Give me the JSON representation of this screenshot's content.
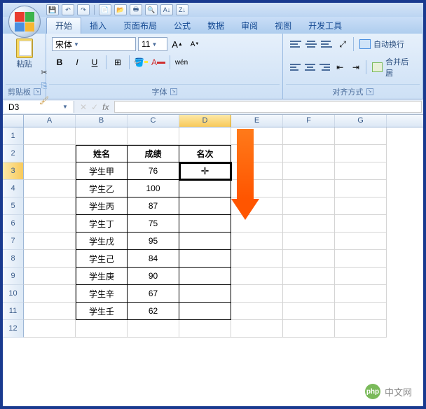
{
  "qat": {
    "save": "💾",
    "undo": "↶",
    "redo": "↷"
  },
  "tabs": [
    "开始",
    "插入",
    "页面布局",
    "公式",
    "数据",
    "审阅",
    "视图",
    "开发工具"
  ],
  "activeTab": 0,
  "ribbon": {
    "clipboard": {
      "paste": "粘贴",
      "label": "剪贴板"
    },
    "font": {
      "name": "宋体",
      "size": "11",
      "label": "字体"
    },
    "alignment": {
      "wrap": "自动换行",
      "merge": "合并后居",
      "label": "对齐方式"
    }
  },
  "namebox": "D3",
  "formula": "",
  "columns": [
    "A",
    "B",
    "C",
    "D",
    "E",
    "F",
    "G"
  ],
  "activeCol": "D",
  "activeRow": 3,
  "activeCell": "D3",
  "table": {
    "headers": [
      "姓名",
      "成绩",
      "名次"
    ],
    "rows": [
      {
        "name": "学生甲",
        "score": "76",
        "rank": ""
      },
      {
        "name": "学生乙",
        "score": "100",
        "rank": ""
      },
      {
        "name": "学生丙",
        "score": "87",
        "rank": ""
      },
      {
        "name": "学生丁",
        "score": "75",
        "rank": ""
      },
      {
        "name": "学生戊",
        "score": "95",
        "rank": ""
      },
      {
        "name": "学生己",
        "score": "84",
        "rank": ""
      },
      {
        "name": "学生庚",
        "score": "90",
        "rank": ""
      },
      {
        "name": "学生辛",
        "score": "67",
        "rank": ""
      },
      {
        "name": "学生壬",
        "score": "62",
        "rank": ""
      }
    ]
  },
  "watermark": "中文网",
  "watermarkPrefix": "php"
}
